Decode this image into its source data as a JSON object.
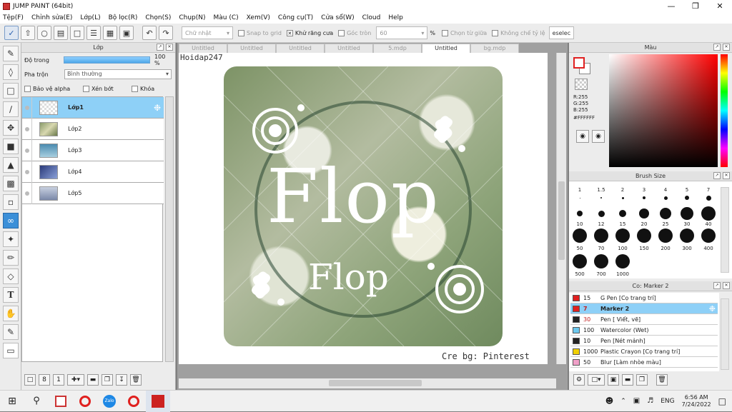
{
  "window": {
    "title": "JUMP PAINT (64bit)"
  },
  "menu": [
    "Tệp(F)",
    "Chỉnh sửa(E)",
    "Lớp(L)",
    "Bộ lọc(R)",
    "Chọn(S)",
    "Chụp(N)",
    "Màu (C)",
    "Xem(V)",
    "Công cụ(T)",
    "Cửa sổ(W)",
    "Cloud",
    "Help"
  ],
  "toolbar": {
    "shape_select": "Chữ nhật",
    "snap_to_grid": "Snap to grid",
    "antialias": "Khử răng cưa",
    "corner_round": "Góc tròn",
    "corner_value": "60",
    "percent": "%",
    "select_center": "Chọn từ giữa",
    "fixed_ratio": "Không chế tỷ lệ",
    "deselect": "eselec"
  },
  "layer_panel": {
    "title": "Lớp",
    "opacity_label": "Độ trong",
    "opacity_value": "100 %",
    "blend_label": "Pha trộn",
    "blend_value": "Bình thường",
    "protect_alpha": "Bảo vệ alpha",
    "clipping": "Xén bớt",
    "lock": "Khóa",
    "layers": [
      "Lớp1",
      "Lớp2",
      "Lớp3",
      "Lớp4",
      "Lớp5"
    ]
  },
  "tabs": [
    "Untitled",
    "Untitled",
    "Untitled",
    "Untitled",
    "5.mdp",
    "Untitled",
    "bg.mdp"
  ],
  "canvas": {
    "watermark_top": "Hoidap247",
    "big_text": "Flop",
    "small_text": "Flop",
    "credit": "Cre bg: Pinterest"
  },
  "color_panel": {
    "title": "Màu",
    "r": "R:255",
    "g": "G:255",
    "b": "B:255",
    "hex": "#FFFFFF"
  },
  "brush_panel": {
    "title": "Brush Size",
    "sizes": [
      "1",
      "1.5",
      "2",
      "3",
      "4",
      "5",
      "7",
      "10",
      "12",
      "15",
      "20",
      "25",
      "30",
      "40",
      "50",
      "70",
      "100",
      "150",
      "200",
      "300",
      "400",
      "500",
      "700",
      "1000"
    ]
  },
  "subtool_panel": {
    "title": "Co: Marker 2",
    "items": [
      {
        "size": "15",
        "name": "G Pen [Cọ trang trí]",
        "color": "#e02020"
      },
      {
        "size": "7",
        "name": "Marker 2",
        "color": "#e02020"
      },
      {
        "size": "30",
        "name": "Pen [ Viết, vẽ]",
        "color": "#222222"
      },
      {
        "size": "100",
        "name": "Watercolor (Wet)",
        "color": "#6cc8ee"
      },
      {
        "size": "10",
        "name": "Pen [Nét mảnh]",
        "color": "#222222"
      },
      {
        "size": "1000",
        "name": "Plastic Crayon [Cọ trang trí]",
        "color": "#f0d000"
      },
      {
        "size": "50",
        "name": "Blur [Làm nhòe màu]",
        "color": "#f0a0c8"
      }
    ]
  },
  "taskbar": {
    "lang": "ENG",
    "time": "6:56 AM",
    "date": "7/24/2022"
  }
}
